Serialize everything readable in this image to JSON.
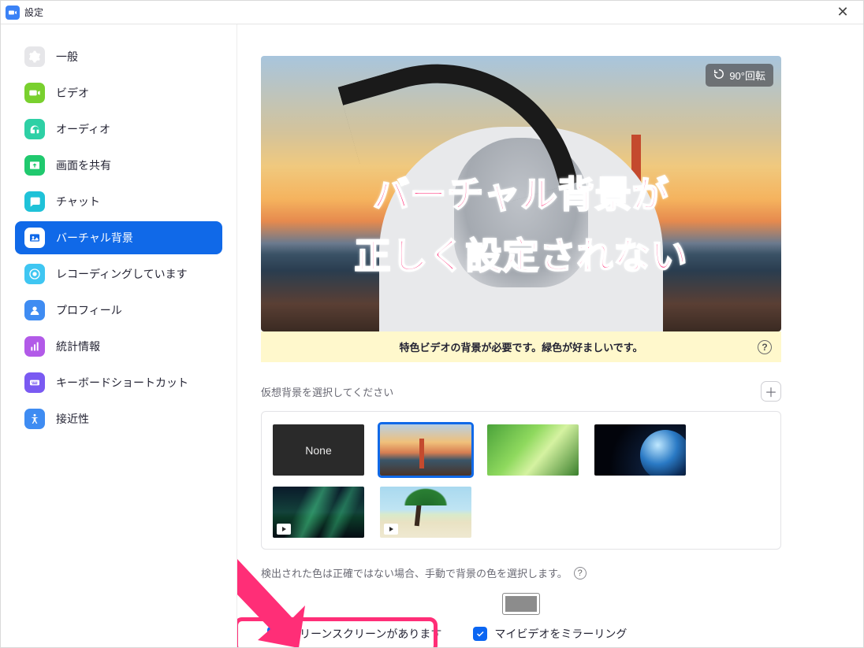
{
  "window": {
    "title": "設定"
  },
  "sidebar": {
    "items": [
      {
        "label": "一般"
      },
      {
        "label": "ビデオ"
      },
      {
        "label": "オーディオ"
      },
      {
        "label": "画面を共有"
      },
      {
        "label": "チャット"
      },
      {
        "label": "バーチャル背景"
      },
      {
        "label": "レコーディングしています"
      },
      {
        "label": "プロフィール"
      },
      {
        "label": "統計情報"
      },
      {
        "label": "キーボードショートカット"
      },
      {
        "label": "接近性"
      }
    ],
    "active_index": 5
  },
  "preview": {
    "rotate_label": "90°回転",
    "overlay_line1": "バーチャル背景が",
    "overlay_line2": "正しく設定されない"
  },
  "warning": {
    "text": "特色ビデオの背景が必要です。緑色が好ましいです。"
  },
  "select_section": {
    "label": "仮想背景を選択してください"
  },
  "thumbs": {
    "none_label": "None",
    "selected_index": 1
  },
  "note": {
    "text": "検出された色は正確ではない場合、手動で背景の色を選択します。"
  },
  "color_swatch": {
    "value": "#8c8c8c"
  },
  "checks": {
    "green_screen": "グリーンスクリーンがあります",
    "mirror": "マイビデオをミラーリング"
  }
}
